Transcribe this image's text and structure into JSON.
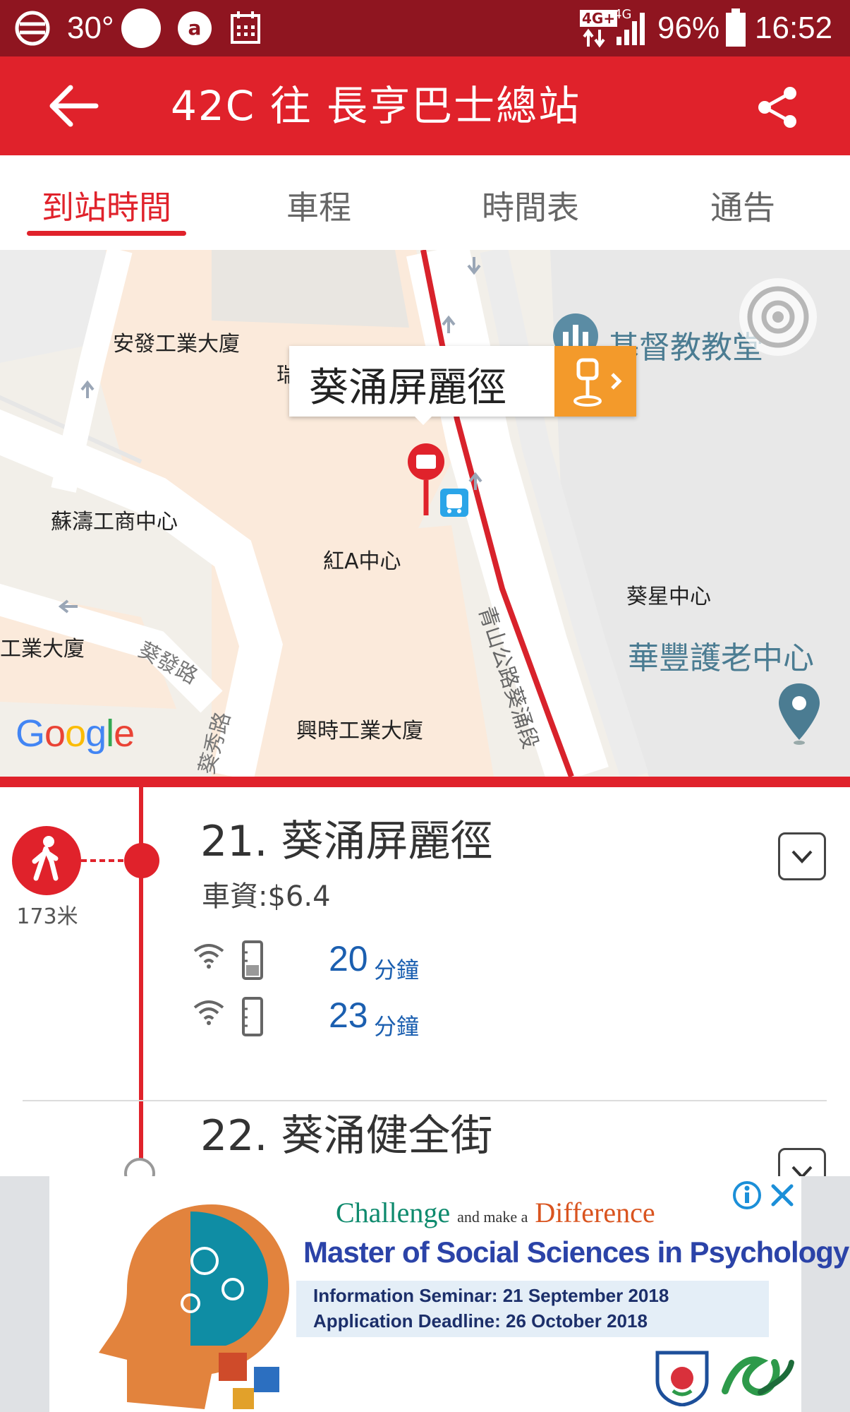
{
  "status_bar": {
    "temperature": "30°",
    "network": "4G+",
    "network_small": "4G",
    "battery": "96%",
    "time": "16:52"
  },
  "header": {
    "title": "42C 往 長亨巴士總站"
  },
  "tabs": [
    {
      "label": "到站時間",
      "active": true
    },
    {
      "label": "車程",
      "active": false
    },
    {
      "label": "時間表",
      "active": false
    },
    {
      "label": "通告",
      "active": false
    }
  ],
  "map": {
    "callout": "葵涌屏麗徑",
    "labels": {
      "anfat": "安發工業大廈",
      "rui": "瑞",
      "church": "基督教教堂",
      "soto": "蘇濤工商中心",
      "redA": "紅A中心",
      "kwaising": "葵星中心",
      "wahfung": "華豐護老中心",
      "industrial": "工業大廈",
      "kwaifat": "葵發路",
      "kwaisau": "葵秀路",
      "hingsi": "興時工業大廈",
      "castlepeak": "青山公路葵涌段"
    },
    "brand": "Google"
  },
  "stops": [
    {
      "title": "21. 葵涌屏麗徑",
      "fare": "車資:$6.4",
      "walk_distance": "173米",
      "etas": [
        {
          "minutes": "20",
          "unit": "分鐘"
        },
        {
          "minutes": "23",
          "unit": "分鐘"
        }
      ]
    },
    {
      "title": "22. 葵涌健全街"
    }
  ],
  "ad": {
    "line1_a": "Challenge",
    "line1_b": "and make a",
    "line1_c": "Difference",
    "line2": "Master of Social Sciences in Psychology",
    "line3": "Information Seminar:  21 September 2018",
    "line4": "Application Deadline:  26 October 2018"
  },
  "colors": {
    "status_bar": "#8f1520",
    "primary": "#e0222b",
    "eta_blue": "#1b5fb0",
    "route_line": "#d8222b",
    "stop_chip": "#f39a2b"
  }
}
